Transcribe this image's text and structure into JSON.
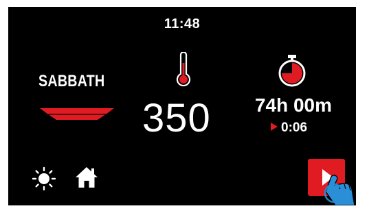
{
  "status_bar": {
    "time": "11:48"
  },
  "mode": {
    "label": "SABBATH",
    "icon": "pan-icon"
  },
  "temperature": {
    "value": "350",
    "icon": "thermometer-icon"
  },
  "timer": {
    "duration": "74h 00m",
    "elapsed": "0:06",
    "icon": "stopwatch-icon"
  },
  "controls": {
    "light": "sun-icon",
    "home": "home-icon",
    "start": "play-icon"
  },
  "colors": {
    "accent": "#e11b22",
    "background": "#000000",
    "text": "#ffffff",
    "touch_hand": "#2a8fd6"
  }
}
